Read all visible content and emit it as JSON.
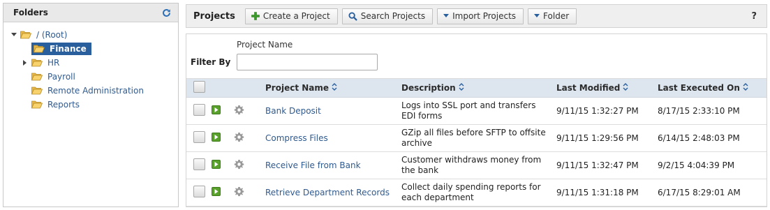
{
  "folders": {
    "title": "Folders",
    "refresh_icon": "refresh-icon",
    "tree": [
      {
        "label": "/ (Root)",
        "expanded": true,
        "selected": false
      },
      {
        "label": "Finance",
        "expanded": false,
        "selected": true
      },
      {
        "label": "HR",
        "expanded": false,
        "selected": false,
        "has_children": true
      },
      {
        "label": "Payroll",
        "expanded": false,
        "selected": false
      },
      {
        "label": "Remote Administration",
        "expanded": false,
        "selected": false
      },
      {
        "label": "Reports",
        "expanded": false,
        "selected": false
      }
    ]
  },
  "toolbar": {
    "title": "Projects",
    "create_label": "Create a Project",
    "search_label": "Search Projects",
    "import_label": "Import Projects",
    "folder_label": "Folder",
    "help_label": "?"
  },
  "filter": {
    "filter_by_label": "Filter By",
    "project_name_label": "Project Name",
    "project_name_value": ""
  },
  "table": {
    "columns": [
      "Project Name",
      "Description",
      "Last Modified",
      "Last Executed On"
    ],
    "rows": [
      {
        "name": "Bank Deposit",
        "description": [
          "Logs into SSL port and transfers",
          "EDI forms"
        ],
        "last_modified": "9/11/15 1:32:27 PM",
        "last_executed": "8/17/15 2:33:10 PM"
      },
      {
        "name": "Compress Files",
        "description": [
          "GZip all files before SFTP to offsite",
          "archive"
        ],
        "last_modified": "9/11/15 1:29:56 PM",
        "last_executed": "6/14/15 2:48:03 PM"
      },
      {
        "name": "Receive File from Bank",
        "description": [
          "Customer withdraws money from",
          "the bank"
        ],
        "last_modified": "9/11/15 1:32:47 PM",
        "last_executed": "9/2/15 4:04:39 PM"
      },
      {
        "name": "Retrieve Department Records",
        "description": [
          "Collect daily spending reports for",
          "each department"
        ],
        "last_modified": "9/11/15 1:31:18 PM",
        "last_executed": "6/17/15 8:29:01 AM"
      }
    ]
  },
  "colors": {
    "accent": "#2a5f9e",
    "link": "#2f5a8f",
    "header_bg": "#dde6ef",
    "run_green": "#5aa02c",
    "create_plus": "#3a9a2a"
  }
}
